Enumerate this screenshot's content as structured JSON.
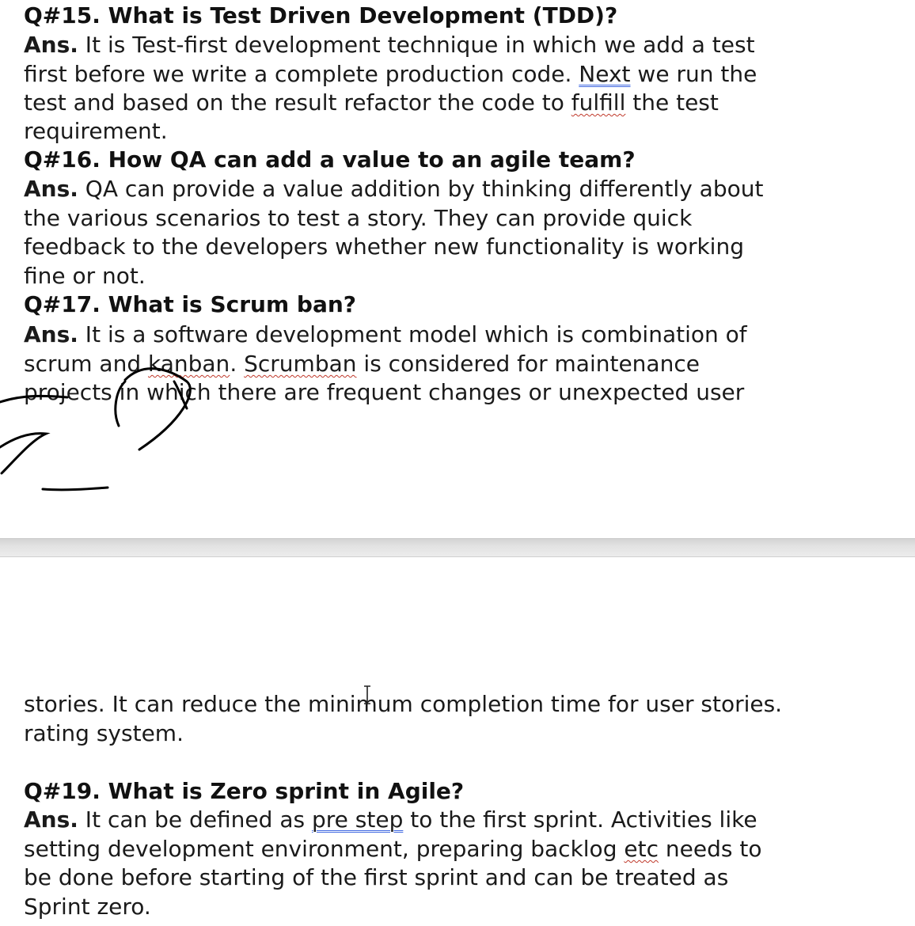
{
  "page1": {
    "q15": {
      "question": "Q#15. What is Test Driven Development (TDD)?",
      "ans_label": "Ans.",
      "l1": " It is Test-first development technique in which we add a test",
      "l2a": "first before we write a complete production code. ",
      "l2b": "Next",
      "l2c": " we run the",
      "l3a": "test and based on the result refactor the code to ",
      "l3b": "fulfill",
      "l3c": " the test",
      "l4": "requirement."
    },
    "q16": {
      "question": "Q#16. How QA can add a value to an agile team?",
      "ans_label": "Ans.",
      "l1": " QA can provide a value addition by thinking differently about",
      "l2": "the various scenarios to test a story. They can provide quick",
      "l3": "feedback to the developers whether new functionality is working",
      "l4": "fine or not."
    },
    "q17": {
      "question": "Q#17. What is Scrum ban?",
      "ans_label": "Ans.",
      "l1": " It is a software development model which is combination of",
      "l2a": "scrum and ",
      "l2b": "kanban",
      "l2c": ". ",
      "l2d": "Scrumban",
      "l2e": " is considered for maintenance",
      "l3": "projects in which there are frequent changes or unexpected user"
    }
  },
  "page2": {
    "cont1": "stories. It can reduce the minimum completion time for user stories.",
    "cont2": "rating system.",
    "q19": {
      "question": "Q#19. What is Zero sprint in Agile?",
      "ans_label": "Ans.",
      "l1a": " It can be defined as ",
      "l1b": "pre step",
      "l1c": " to the first sprint. Activities like",
      "l2a": "setting development environment, preparing backlog ",
      "l2b": "etc",
      "l2c": " needs to",
      "l3": "be done before starting of the first sprint and can be treated as",
      "l4": "Sprint zero."
    }
  },
  "colors": {
    "text": "#1a1a1a",
    "spellcheck_underline": "#c0392b",
    "grammar_underline": "#4169e1",
    "page_gap": "#e2e2e2",
    "ink": "#000000"
  },
  "icons": {
    "cursor": "text-cursor-icon",
    "scribble": "hand-drawn-scribble"
  }
}
